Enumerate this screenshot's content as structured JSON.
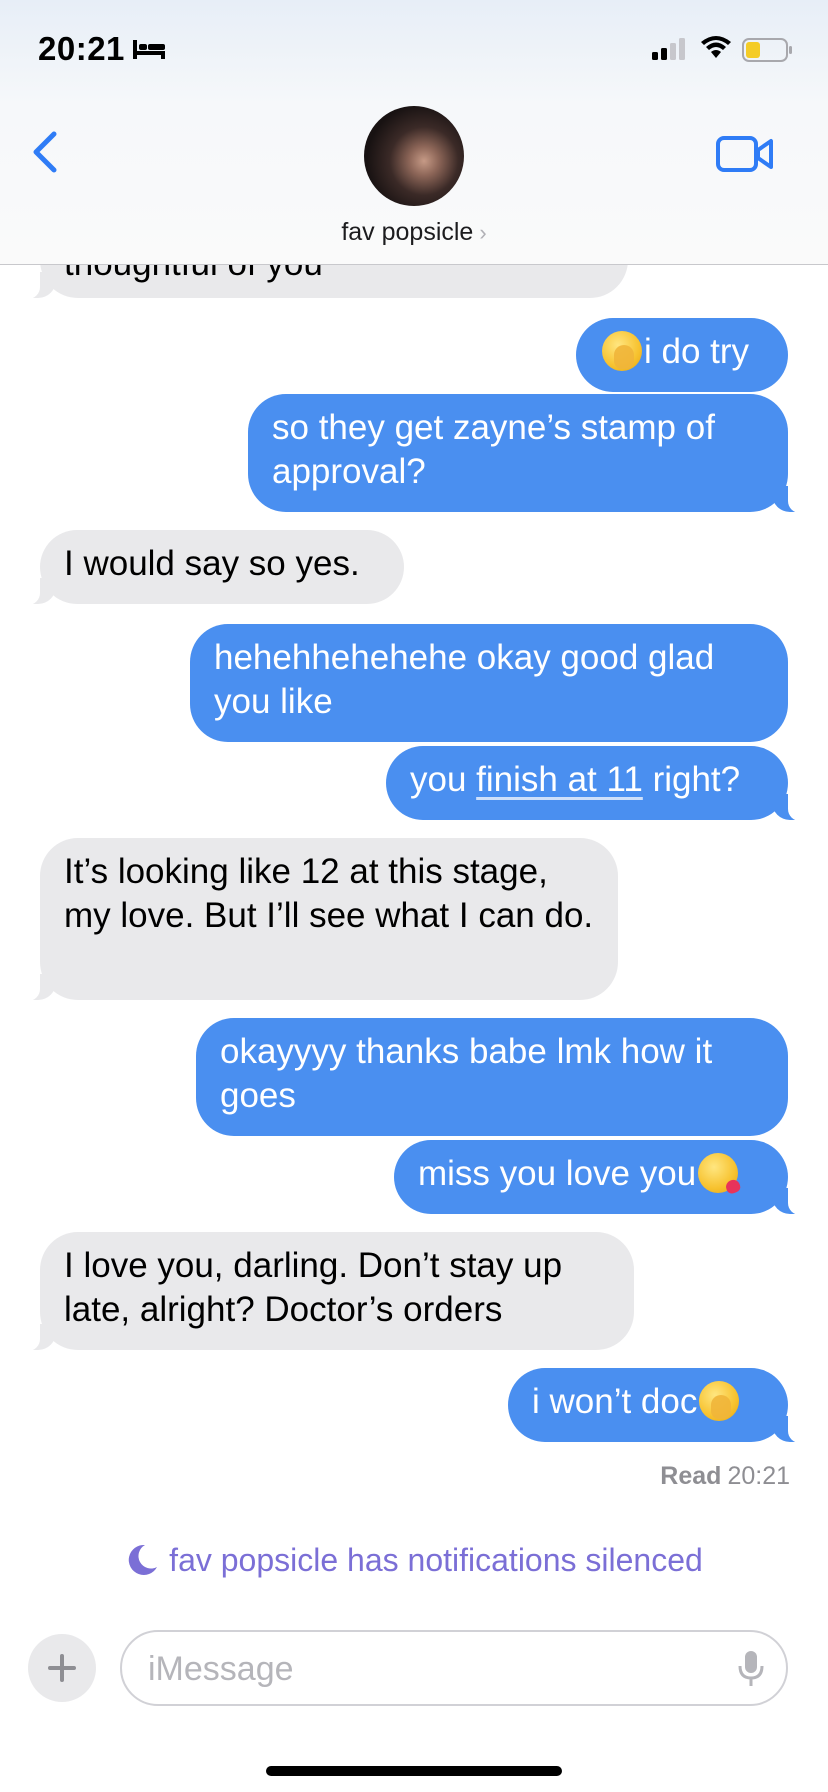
{
  "status_bar": {
    "time": "20:21",
    "icons": [
      "bed-icon",
      "signal-icon",
      "wifi-icon",
      "battery-icon"
    ]
  },
  "header": {
    "contact_name": "fav popsicle",
    "chevron": "›",
    "icons": [
      "back-chevron-icon",
      "avatar",
      "video-camera-icon"
    ]
  },
  "messages": [
    {
      "from": "them",
      "text": "thoughtful of you"
    },
    {
      "from": "me",
      "emoji": "face-with-hand-over-mouth",
      "text": "i do try"
    },
    {
      "from": "me",
      "text": "so they get zayne’s stamp of approval?"
    },
    {
      "from": "them",
      "text": "I would say so yes."
    },
    {
      "from": "me",
      "text": "hehehhehehehe okay good glad you like"
    },
    {
      "from": "me",
      "text_before": "you ",
      "link": "finish at 11",
      "text_after": " right?"
    },
    {
      "from": "them",
      "text": "It’s looking like 12 at this stage, my love. But I’ll see what I can do."
    },
    {
      "from": "me",
      "text": "okayyyy thanks babe lmk how it goes"
    },
    {
      "from": "me",
      "text": "miss you love you",
      "emoji": "face-blowing-a-kiss"
    },
    {
      "from": "them",
      "text": "I love you, darling. Don’t stay up late, alright? Doctor’s orders"
    },
    {
      "from": "me",
      "text": "i won’t doc",
      "emoji": "face-with-hand-over-mouth"
    }
  ],
  "read_receipt": {
    "label": "Read",
    "time": "20:21"
  },
  "silenced_notice": "fav popsicle has notifications silenced",
  "composer": {
    "placeholder": "iMessage",
    "value": "",
    "plus_label": "+"
  },
  "colors": {
    "outgoing": "#4a8ff0",
    "incoming": "#e9e9eb",
    "accent": "#2f7cf6",
    "silenced": "#7b6fd6"
  }
}
